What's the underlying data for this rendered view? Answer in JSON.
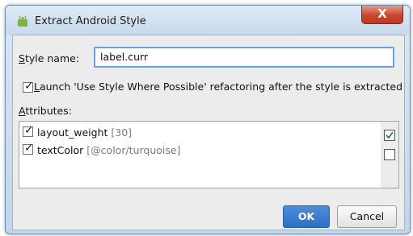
{
  "window": {
    "title": "Extract Android Style",
    "close_label": "X"
  },
  "form": {
    "style_name_label": "Style name:",
    "style_name_value": "label.curr",
    "launch_label": "Launch 'Use Style Where Possible' refactoring after the style is extracted",
    "launch_checked": true,
    "attributes_label": "Attributes:"
  },
  "attributes": [
    {
      "name": "layout_weight",
      "value": "[30]",
      "checked": true
    },
    {
      "name": "textColor",
      "value": "[@color/turquoise]",
      "checked": true
    }
  ],
  "side_controls": [
    {
      "icon": "select-all-icon"
    },
    {
      "icon": "select-none-icon"
    }
  ],
  "buttons": {
    "ok": "OK",
    "cancel": "Cancel"
  },
  "colors": {
    "ok_button": "#2f6fc4",
    "close_button": "#c9452f",
    "input_focus": "#66a3e3"
  }
}
